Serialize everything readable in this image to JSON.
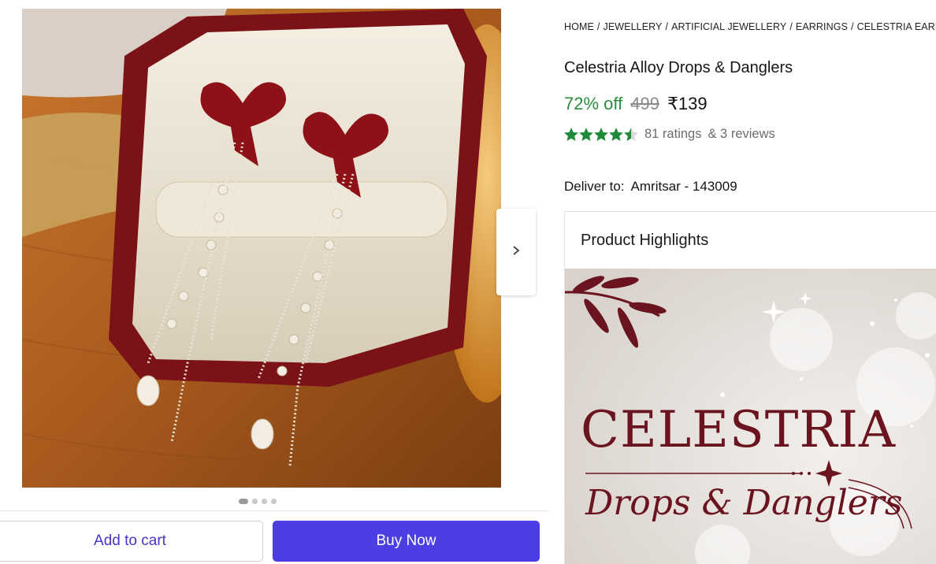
{
  "gallery": {
    "image_alt": "Celestria red bow earrings in jewellery box",
    "dots": [
      {
        "active": true
      },
      {
        "active": false
      },
      {
        "active": false
      },
      {
        "active": false
      }
    ],
    "next_icon": "chevron-right-icon"
  },
  "actions": {
    "add_to_cart": "Add to cart",
    "buy_now": "Buy Now"
  },
  "breadcrumb": [
    "HOME",
    "JEWELLERY",
    "ARTIFICIAL JEWELLERY",
    "EARRINGS",
    "CELESTRIA EARRINGS"
  ],
  "product": {
    "title": "Celestria Alloy Drops & Danglers",
    "discount": "72% off",
    "mrp": "499",
    "price": "₹139",
    "rating_value": 4.5,
    "ratings_text": "81 ratings",
    "reviews_text": "& 3 reviews"
  },
  "delivery": {
    "label": "Deliver to:",
    "location": "Amritsar - 143009"
  },
  "highlights": {
    "heading": "Product Highlights",
    "banner_line1": "CELESTRIA",
    "banner_line2": "Drops & Danglers"
  },
  "colors": {
    "accent": "#4b3ee3",
    "discount_green": "#2a8d3d",
    "star_green": "#1f8a3a",
    "brand_maroon": "#6a1420"
  }
}
